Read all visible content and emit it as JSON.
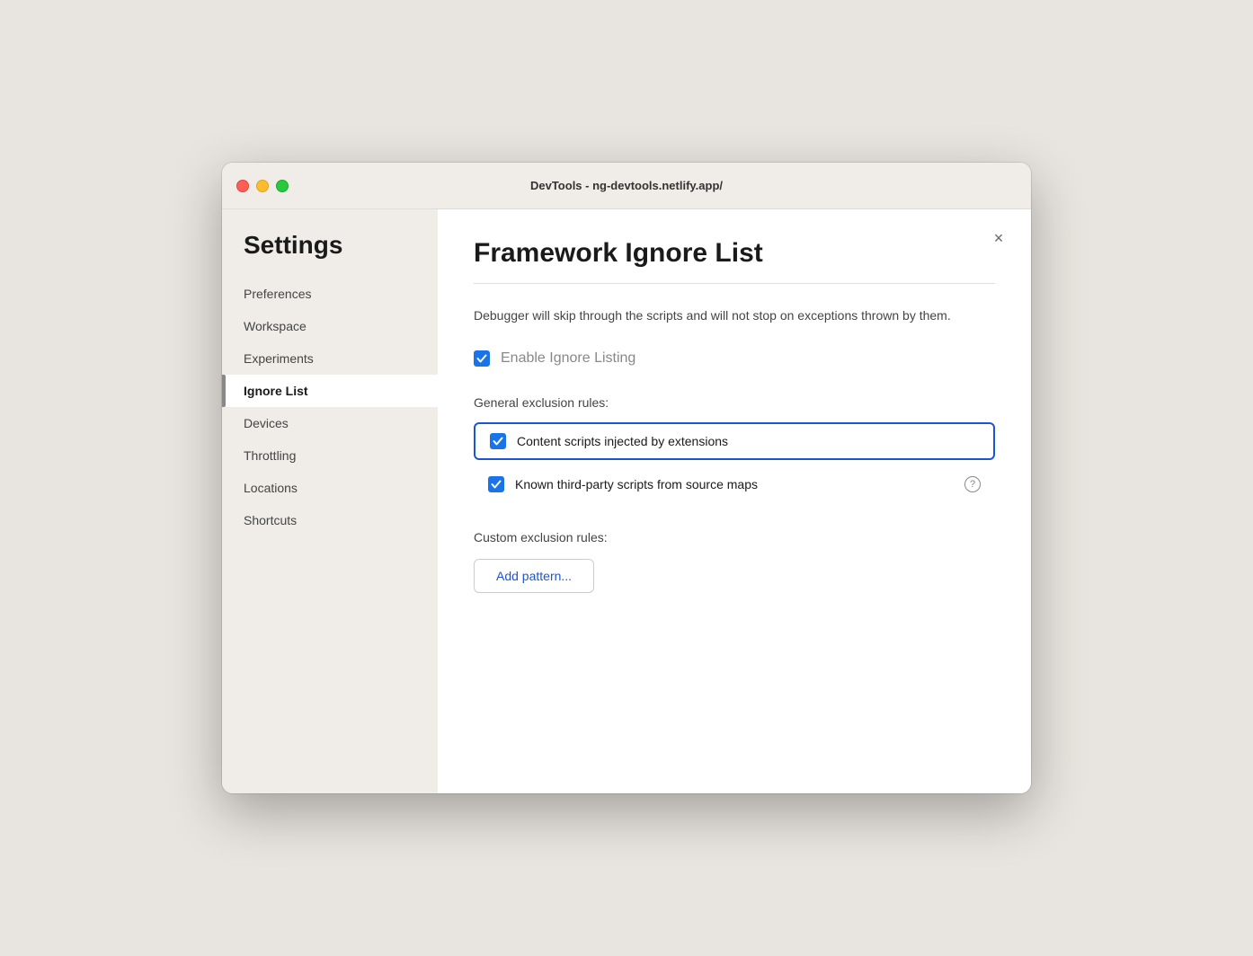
{
  "titlebar": {
    "title": "DevTools - ng-devtools.netlify.app/"
  },
  "sidebar": {
    "heading": "Settings",
    "items": [
      {
        "id": "preferences",
        "label": "Preferences",
        "active": false
      },
      {
        "id": "workspace",
        "label": "Workspace",
        "active": false
      },
      {
        "id": "experiments",
        "label": "Experiments",
        "active": false
      },
      {
        "id": "ignore-list",
        "label": "Ignore List",
        "active": true
      },
      {
        "id": "devices",
        "label": "Devices",
        "active": false
      },
      {
        "id": "throttling",
        "label": "Throttling",
        "active": false
      },
      {
        "id": "locations",
        "label": "Locations",
        "active": false
      },
      {
        "id": "shortcuts",
        "label": "Shortcuts",
        "active": false
      }
    ]
  },
  "main": {
    "title": "Framework Ignore List",
    "description": "Debugger will skip through the scripts and will not stop on exceptions thrown by them.",
    "enable_ignore_listing_label": "Enable Ignore Listing",
    "general_exclusion_label": "General exclusion rules:",
    "rules": [
      {
        "id": "content-scripts",
        "label": "Content scripts injected by extensions",
        "checked": true,
        "highlighted": true,
        "has_help": false
      },
      {
        "id": "third-party-scripts",
        "label": "Known third-party scripts from source maps",
        "checked": true,
        "highlighted": false,
        "has_help": true
      }
    ],
    "custom_exclusion_label": "Custom exclusion rules:",
    "add_pattern_label": "Add pattern...",
    "close_label": "×"
  },
  "traffic_lights": {
    "close_title": "Close",
    "minimize_title": "Minimize",
    "maximize_title": "Maximize"
  }
}
